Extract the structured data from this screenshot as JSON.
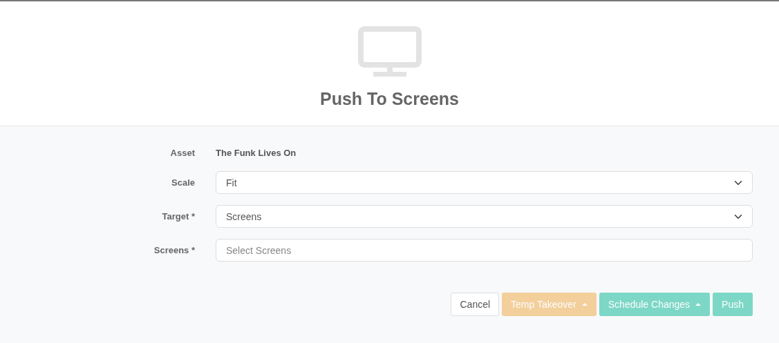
{
  "header": {
    "title": "Push To Screens"
  },
  "fields": [
    {
      "kind": "text",
      "label": "Asset",
      "value": "The Funk Lives On"
    },
    {
      "kind": "select",
      "label": "Scale",
      "value": "Fit"
    },
    {
      "kind": "select",
      "label": "Target *",
      "value": "Screens"
    },
    {
      "kind": "input",
      "label": "Screens *",
      "placeholder": "Select Screens"
    }
  ],
  "buttons": [
    {
      "kind": "plain",
      "label": "Cancel",
      "disabled": false,
      "dropdown": false
    },
    {
      "kind": "warning",
      "label": "Temp Takeover",
      "disabled": true,
      "dropdown": true
    },
    {
      "kind": "success",
      "label": "Schedule Changes",
      "disabled": true,
      "dropdown": true
    },
    {
      "kind": "success",
      "label": "Push",
      "disabled": true,
      "dropdown": false
    }
  ]
}
